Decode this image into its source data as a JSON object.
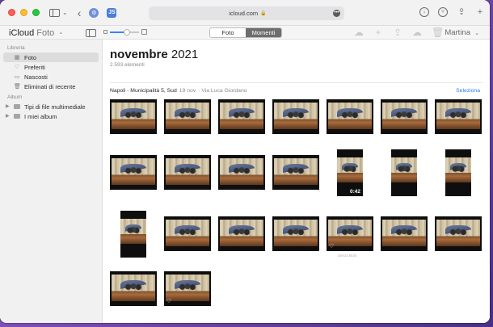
{
  "browser": {
    "url": "icloud.com",
    "ext1_label": "⚙",
    "ext2_label": "JS"
  },
  "app": {
    "title_main": "iCloud",
    "title_sub": "Foto",
    "view_tabs": [
      {
        "label": "Foto",
        "active": false
      },
      {
        "label": "Momenti",
        "active": true
      }
    ],
    "user": "Martina",
    "zoom_level": 0.58
  },
  "sidebar": {
    "library_label": "Libreria",
    "library_items": [
      {
        "label": "Foto",
        "icon": "photos-icon",
        "selected": true
      },
      {
        "label": "Preferiti",
        "icon": "heart-icon",
        "selected": false
      },
      {
        "label": "Nascosti",
        "icon": "hidden-icon",
        "selected": false
      },
      {
        "label": "Eliminati di recente",
        "icon": "trash-icon",
        "selected": false
      }
    ],
    "album_label": "Album",
    "album_items": [
      {
        "label": "Tipi di file multimediale"
      },
      {
        "label": "I miei album"
      }
    ]
  },
  "main": {
    "month": "novembre",
    "year": "2021",
    "count": "2.593 elementi",
    "moment_location": "Napoli - Municipalità 5, Sud",
    "moment_date": "19 nov",
    "moment_place": "· Via Luca Giordano",
    "select_label": "Seleziona",
    "video_duration": "0:42",
    "caption_text": "Senza titolo"
  },
  "colors": {
    "accent": "#2c7be5",
    "desktop": "#6a48ae"
  }
}
